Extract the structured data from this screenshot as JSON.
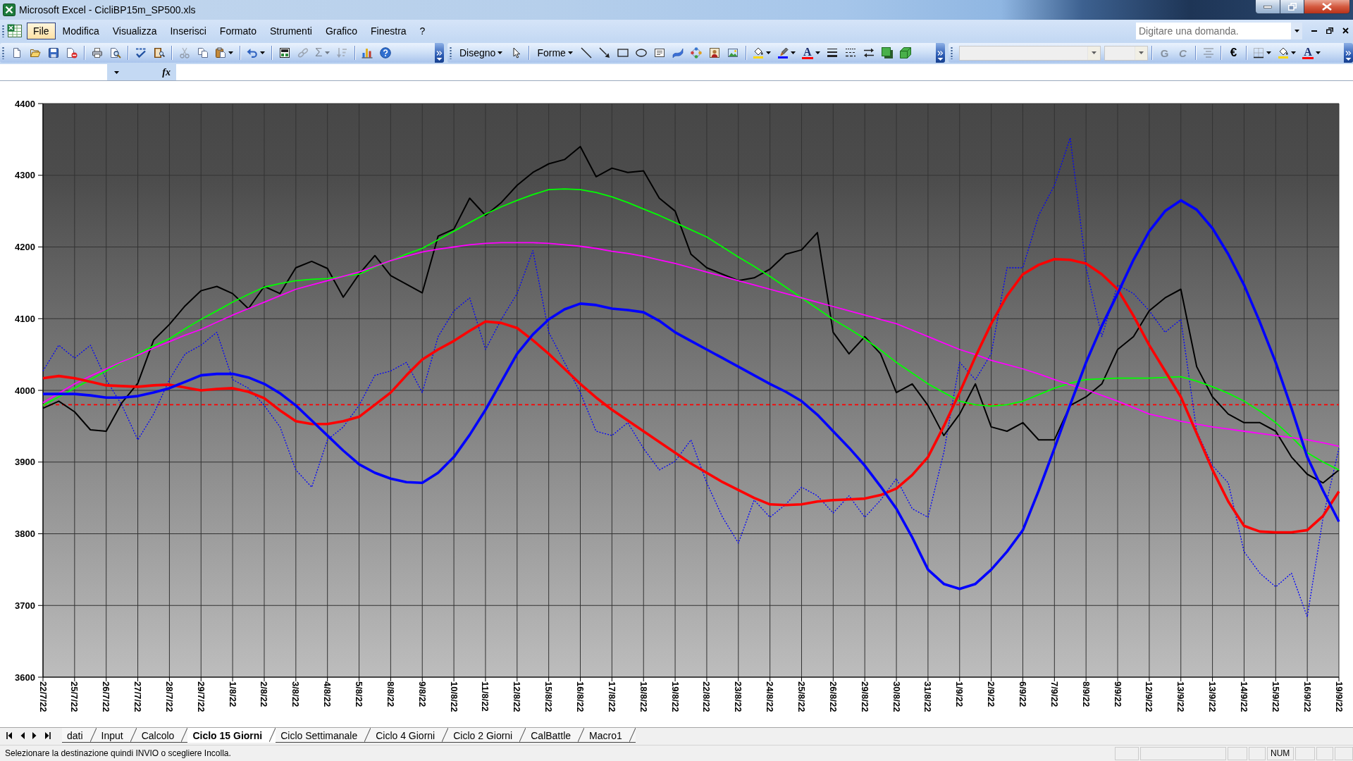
{
  "window": {
    "title": "Microsoft Excel - CicliBP15m_SP500.xls"
  },
  "menu_bar": {
    "items": [
      {
        "label": "File",
        "selected": true
      },
      {
        "label": "Modifica",
        "selected": false
      },
      {
        "label": "Visualizza",
        "selected": false
      },
      {
        "label": "Inserisci",
        "selected": false
      },
      {
        "label": "Formato",
        "selected": false
      },
      {
        "label": "Strumenti",
        "selected": false
      },
      {
        "label": "Grafico",
        "selected": false
      },
      {
        "label": "Finestra",
        "selected": false
      },
      {
        "label": "?",
        "selected": false
      }
    ],
    "help_search": {
      "placeholder": "Digitare una domanda."
    }
  },
  "toolbars": [
    {
      "items": [
        {
          "kind": "icon",
          "disabled": false,
          "dropdown": false
        },
        {
          "kind": "icon",
          "disabled": false,
          "dropdown": false
        },
        {
          "kind": "icon",
          "disabled": false,
          "dropdown": false
        },
        {
          "kind": "icon",
          "disabled": false,
          "dropdown": false
        },
        {
          "kind": "separator"
        },
        {
          "kind": "icon",
          "disabled": false,
          "dropdown": false
        },
        {
          "kind": "icon",
          "disabled": false,
          "dropdown": false
        },
        {
          "kind": "separator"
        },
        {
          "kind": "icon",
          "disabled": false,
          "dropdown": false
        },
        {
          "kind": "icon",
          "disabled": false,
          "dropdown": false
        },
        {
          "kind": "separator"
        },
        {
          "kind": "icon",
          "disabled": true,
          "dropdown": false
        },
        {
          "kind": "icon",
          "disabled": false,
          "dropdown": false
        },
        {
          "kind": "icon",
          "disabled": false,
          "dropdown": true
        },
        {
          "kind": "separator"
        },
        {
          "kind": "icon",
          "disabled": false,
          "dropdown": true
        },
        {
          "kind": "separator"
        },
        {
          "kind": "icon",
          "disabled": false,
          "dropdown": false
        },
        {
          "kind": "icon",
          "disabled": true,
          "dropdown": false
        },
        {
          "kind": "text",
          "label": "Σ",
          "disabled": true,
          "dropdown": true
        },
        {
          "kind": "icon",
          "disabled": true,
          "dropdown": false
        },
        {
          "kind": "separator"
        },
        {
          "kind": "icon",
          "disabled": false,
          "dropdown": false
        },
        {
          "kind": "icon",
          "disabled": false,
          "dropdown": false
        }
      ]
    },
    {
      "items": [
        {
          "kind": "menu",
          "label": "Disegno",
          "disabled": false
        },
        {
          "kind": "icon",
          "disabled": false,
          "dropdown": false
        },
        {
          "kind": "separator"
        },
        {
          "kind": "menu",
          "label": "Forme",
          "disabled": false
        },
        {
          "kind": "icon",
          "disabled": false,
          "dropdown": false
        },
        {
          "kind": "icon",
          "disabled": false,
          "dropdown": false
        },
        {
          "kind": "icon",
          "disabled": false,
          "dropdown": false
        },
        {
          "kind": "icon",
          "disabled": false,
          "dropdown": false
        },
        {
          "kind": "icon",
          "disabled": false,
          "dropdown": false
        },
        {
          "kind": "icon",
          "disabled": false,
          "dropdown": false
        },
        {
          "kind": "icon",
          "disabled": false,
          "dropdown": false
        },
        {
          "kind": "icon",
          "disabled": false,
          "dropdown": false
        },
        {
          "kind": "icon",
          "disabled": false,
          "dropdown": false
        },
        {
          "kind": "separator"
        },
        {
          "kind": "icon",
          "disabled": false,
          "dropdown": true
        },
        {
          "kind": "icon",
          "disabled": false,
          "dropdown": true
        },
        {
          "kind": "text",
          "label": "A",
          "disabled": false,
          "dropdown": true,
          "color": "#ff0000"
        },
        {
          "kind": "icon",
          "disabled": false,
          "dropdown": false
        },
        {
          "kind": "icon",
          "disabled": false,
          "dropdown": false
        },
        {
          "kind": "icon",
          "disabled": false,
          "dropdown": false
        },
        {
          "kind": "icon",
          "disabled": false,
          "dropdown": false
        },
        {
          "kind": "icon",
          "disabled": false,
          "dropdown": false
        }
      ]
    },
    {
      "items": [
        {
          "kind": "combo",
          "disabled": true
        },
        {
          "kind": "combo",
          "disabled": true
        },
        {
          "kind": "separator"
        },
        {
          "kind": "text",
          "label": "G",
          "disabled": true,
          "dropdown": false
        },
        {
          "kind": "text",
          "label": "C",
          "disabled": true,
          "dropdown": false
        },
        {
          "kind": "separator"
        },
        {
          "kind": "icon",
          "disabled": true,
          "dropdown": false
        },
        {
          "kind": "separator"
        },
        {
          "kind": "text",
          "label": "€",
          "disabled": false,
          "dropdown": false
        },
        {
          "kind": "separator"
        },
        {
          "kind": "icon",
          "disabled": false,
          "dropdown": true
        },
        {
          "kind": "icon",
          "disabled": false,
          "dropdown": true
        },
        {
          "kind": "text",
          "label": "A",
          "disabled": false,
          "dropdown": true,
          "color": "#ff0000"
        }
      ]
    }
  ],
  "formula_bar": {
    "function_label": "fx"
  },
  "chart": {
    "chart_data": {
      "type": "line",
      "categories": [
        "22/7/22",
        null,
        "25/7/22",
        null,
        "26/7/22",
        null,
        "27/7/22",
        null,
        "28/7/22",
        null,
        "29/7/22",
        null,
        "1/8/22",
        null,
        "2/8/22",
        null,
        "3/8/22",
        null,
        "4/8/22",
        null,
        "5/8/22",
        null,
        "8/8/22",
        null,
        "9/8/22",
        null,
        "10/8/22",
        null,
        "11/8/22",
        null,
        "12/8/22",
        null,
        "15/8/22",
        null,
        "16/8/22",
        null,
        "17/8/22",
        null,
        "18/8/22",
        null,
        "19/8/22",
        null,
        "22/8/22",
        null,
        "23/8/22",
        null,
        "24/8/22",
        null,
        "25/8/22",
        null,
        "26/8/22",
        null,
        "29/8/22",
        null,
        "30/8/22",
        null,
        "31/8/22",
        null,
        "1/9/22",
        null,
        "2/9/22",
        null,
        "6/9/22",
        null,
        "7/9/22",
        null,
        "8/9/22",
        null,
        "9/9/22",
        null,
        "12/9/22",
        null,
        "13/9/22",
        null,
        "13/9/22",
        null,
        "14/9/22",
        null,
        "15/9/22",
        null,
        "16/9/22",
        null,
        "19/9/22"
      ],
      "ylim": [
        3600,
        4400
      ],
      "yticks": [
        3600,
        3700,
        3800,
        3900,
        4000,
        4100,
        4200,
        4300,
        4400
      ],
      "grid": true,
      "ref_lines": [
        {
          "axis": "y",
          "value": 3980,
          "color": "#ff0000",
          "line_style": "dashed"
        }
      ],
      "series": [
        {
          "color": "#0000ff",
          "line_style": "dotted",
          "values": [
            4027,
            4063,
            4045,
            4063,
            4015,
            3979,
            3931,
            3967,
            4015,
            4051,
            4063,
            4081,
            4015,
            4003,
            3979,
            3949,
            3889,
            3865,
            3931,
            3949,
            3979,
            4021,
            4027,
            4039,
            3997,
            4075,
            4111,
            4129,
            4057,
            4099,
            4135,
            4195,
            4081,
            4039,
            3997,
            3943,
            3937,
            3955,
            3919,
            3889,
            3901,
            3931,
            3871,
            3823,
            3787,
            3847,
            3823,
            3841,
            3865,
            3853,
            3829,
            3853,
            3823,
            3847,
            3877,
            3835,
            3823,
            3913,
            4039,
            4015,
            4051,
            4171,
            4171,
            4244,
            4286,
            4352,
            4171,
            4075,
            4147,
            4135,
            4111,
            4081,
            4099,
            3943,
            3895,
            3871,
            3775,
            3745,
            3726,
            3745,
            3684,
            3823,
            3919
          ]
        },
        {
          "color": "#000000",
          "line_style": "solid",
          "values": [
            3975,
            3985,
            3970,
            3945,
            3943,
            3983,
            4010,
            4070,
            4092,
            4118,
            4139,
            4145,
            4135,
            4114,
            4145,
            4135,
            4171,
            4180,
            4170,
            4130,
            4162,
            4188,
            4160,
            4148,
            4136,
            4215,
            4225,
            4268,
            4244,
            4262,
            4286,
            4304,
            4316,
            4322,
            4340,
            4298,
            4310,
            4304,
            4306,
            4268,
            4250,
            4190,
            4171,
            4162,
            4153,
            4157,
            4169,
            4190,
            4196,
            4220,
            4081,
            4051,
            4075,
            4051,
            3997,
            4009,
            3979,
            3937,
            3967,
            4009,
            3949,
            3943,
            3955,
            3931,
            3931,
            3979,
            3991,
            4009,
            4057,
            4075,
            4111,
            4129,
            4141,
            4033,
            3991,
            3967,
            3955,
            3955,
            3943,
            3907,
            3883,
            3871,
            3889
          ]
        },
        {
          "color": "#00ff00",
          "line_style": "solid",
          "values": [
            3979,
            3991,
            4003,
            4015,
            4027,
            4039,
            4051,
            4062,
            4072,
            4086,
            4099,
            4111,
            4123,
            4134,
            4144,
            4149,
            4153,
            4155,
            4156,
            4159,
            4162,
            4172,
            4181,
            4190,
            4198,
            4210,
            4222,
            4234,
            4246,
            4256,
            4265,
            4273,
            4280,
            4281,
            4280,
            4276,
            4270,
            4262,
            4253,
            4244,
            4234,
            4224,
            4214,
            4200,
            4186,
            4173,
            4159,
            4144,
            4129,
            4114,
            4099,
            4086,
            4072,
            4056,
            4039,
            4024,
            4009,
            3997,
            3985,
            3980,
            3978,
            3980,
            3985,
            3994,
            4003,
            4010,
            4015,
            4016,
            4017,
            4017,
            4017,
            4018,
            4019,
            4013,
            4005,
            3996,
            3985,
            3971,
            3955,
            3935,
            3913,
            3900,
            3889
          ]
        },
        {
          "color": "#ff00ff",
          "line_style": "solid",
          "values": [
            3983,
            3996,
            4009,
            4020,
            4030,
            4040,
            4049,
            4059,
            4068,
            4077,
            4085,
            4095,
            4105,
            4114,
            4123,
            4132,
            4141,
            4147,
            4153,
            4159,
            4165,
            4173,
            4181,
            4187,
            4193,
            4197,
            4200,
            4203,
            4205,
            4206,
            4206,
            4206,
            4205,
            4203,
            4201,
            4198,
            4194,
            4191,
            4187,
            4182,
            4177,
            4171,
            4165,
            4159,
            4153,
            4147,
            4141,
            4135,
            4129,
            4123,
            4117,
            4111,
            4105,
            4099,
            4093,
            4084,
            4075,
            4066,
            4057,
            4050,
            4042,
            4036,
            4030,
            4023,
            4015,
            4008,
            4001,
            3993,
            3985,
            3976,
            3967,
            3962,
            3957,
            3953,
            3949,
            3946,
            3943,
            3940,
            3937,
            3934,
            3931,
            3927,
            3922
          ]
        },
        {
          "color": "#ff0000",
          "line_style": "solid",
          "values": [
            4017,
            4020,
            4017,
            4012,
            4007,
            4006,
            4005,
            4007,
            4008,
            4004,
            4000,
            4002,
            4003,
            3998,
            3989,
            3972,
            3957,
            3953,
            3953,
            3957,
            3963,
            3980,
            3997,
            4021,
            4043,
            4057,
            4069,
            4083,
            4096,
            4094,
            4087,
            4070,
            4051,
            4030,
            4009,
            3990,
            3973,
            3958,
            3943,
            3928,
            3913,
            3898,
            3885,
            3872,
            3861,
            3850,
            3841,
            3840,
            3841,
            3845,
            3847,
            3848,
            3849,
            3854,
            3863,
            3882,
            3907,
            3950,
            3997,
            4047,
            4093,
            4132,
            4162,
            4175,
            4183,
            4182,
            4177,
            4162,
            4141,
            4104,
            4063,
            4027,
            3991,
            3940,
            3889,
            3845,
            3811,
            3803,
            3802,
            3802,
            3805,
            3825,
            3859
          ]
        },
        {
          "color": "#0000ff",
          "line_style": "solid",
          "values": [
            3995,
            3995,
            3995,
            3993,
            3990,
            3990,
            3992,
            3997,
            4003,
            4012,
            4021,
            4023,
            4023,
            4018,
            4009,
            3996,
            3979,
            3958,
            3937,
            3916,
            3897,
            3885,
            3877,
            3872,
            3871,
            3885,
            3907,
            3938,
            3973,
            4012,
            4051,
            4078,
            4099,
            4113,
            4121,
            4119,
            4114,
            4112,
            4109,
            4097,
            4081,
            4069,
            4057,
            4045,
            4033,
            4021,
            4009,
            3998,
            3985,
            3966,
            3943,
            3920,
            3895,
            3866,
            3835,
            3795,
            3750,
            3730,
            3723,
            3730,
            3750,
            3775,
            3805,
            3860,
            3919,
            3980,
            4039,
            4090,
            4135,
            4182,
            4222,
            4250,
            4265,
            4252,
            4226,
            4190,
            4147,
            4095,
            4039,
            3975,
            3907,
            3860,
            3817
          ]
        }
      ]
    }
  },
  "sheet_tabs": [
    {
      "label": "dati",
      "selected": false
    },
    {
      "label": "Input",
      "selected": false
    },
    {
      "label": "Calcolo",
      "selected": false
    },
    {
      "label": "Ciclo 15 Giorni",
      "selected": true
    },
    {
      "label": "Ciclo Settimanale",
      "selected": false
    },
    {
      "label": "Ciclo 4 Giorni",
      "selected": false
    },
    {
      "label": "Ciclo 2 Giorni",
      "selected": false
    },
    {
      "label": "CalBattle",
      "selected": false
    },
    {
      "label": "Macro1",
      "selected": false
    }
  ],
  "status_bar": {
    "message": "Selezionare la destinazione quindi INVIO o scegliere Incolla.",
    "indicators": [
      "NUM"
    ]
  }
}
